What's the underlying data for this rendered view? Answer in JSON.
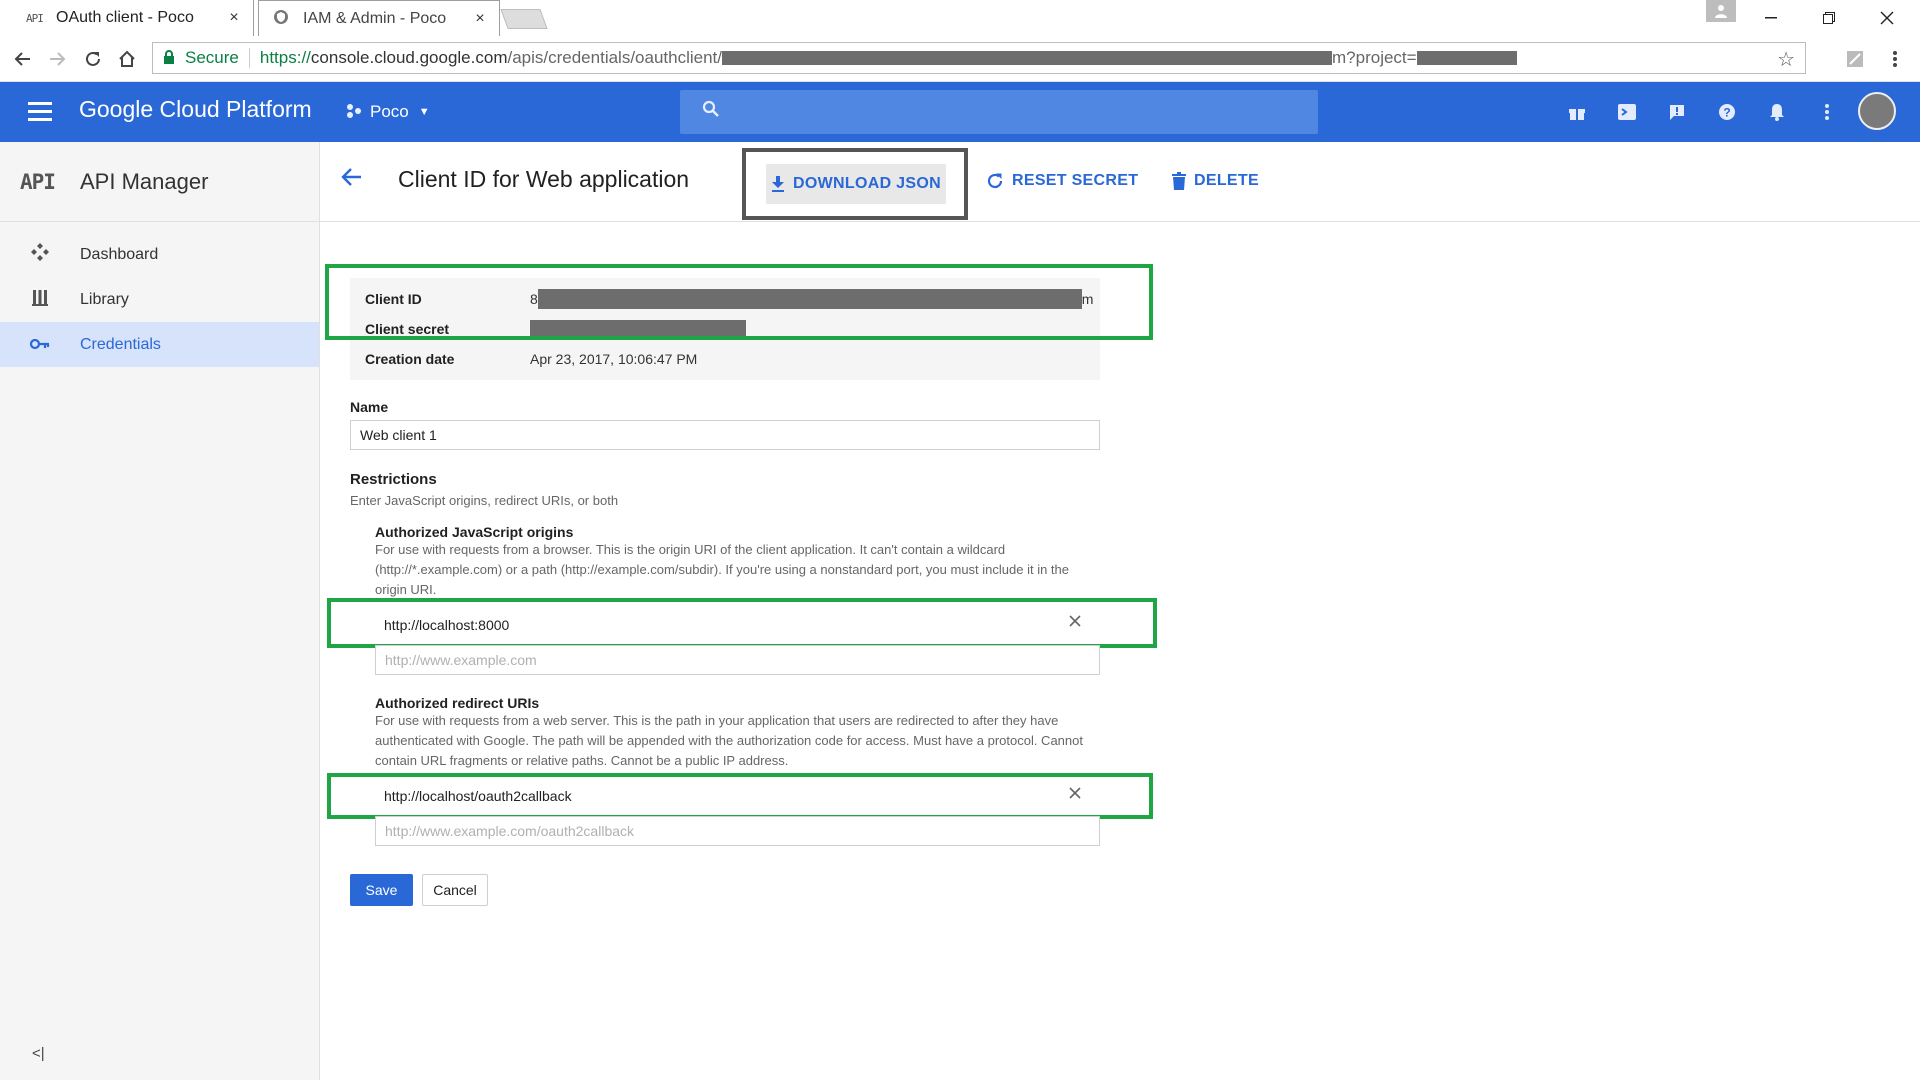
{
  "browser": {
    "tabs": [
      {
        "favicon": "API",
        "label": "OAuth client - Poco",
        "close": "×"
      },
      {
        "favicon": "shield",
        "label": "IAM & Admin - Poco",
        "close": "×"
      }
    ],
    "secure_label": "Secure",
    "url_prefix": "https://",
    "url_host": "console.cloud.google.com",
    "url_path": "/apis/credentials/oauthclient/",
    "url_suffix_tail": "m?project="
  },
  "header": {
    "brand": "Google Cloud Platform",
    "project": "Poco"
  },
  "sidebar": {
    "logo": "API",
    "title": "API Manager",
    "items": [
      {
        "label": "Dashboard",
        "icon": "dashboard-icon"
      },
      {
        "label": "Library",
        "icon": "library-icon"
      },
      {
        "label": "Credentials",
        "icon": "key-icon",
        "active": true
      }
    ],
    "collapse_label": "<|"
  },
  "page": {
    "title": "Client ID for Web application",
    "download_label": "DOWNLOAD JSON",
    "reset_label": "RESET SECRET",
    "delete_label": "DELETE"
  },
  "details": {
    "client_id_label": "Client ID",
    "client_id_prefix": "8",
    "client_id_suffix": "m",
    "client_secret_label": "Client secret",
    "creation_label": "Creation date",
    "creation_value": "Apr 23, 2017, 10:06:47 PM"
  },
  "form": {
    "name_label": "Name",
    "name_value": "Web client 1",
    "restrictions_label": "Restrictions",
    "restrictions_help": "Enter JavaScript origins, redirect URIs, or both",
    "js_origins_label": "Authorized JavaScript origins",
    "js_origins_help": "For use with requests from a browser. This is the origin URI of the client application. It can't contain a wildcard (http://*.example.com) or a path (http://example.com/subdir). If you're using a nonstandard port, you must include it in the origin URI.",
    "js_origin_value": "http://localhost:8000",
    "js_origin_placeholder": "http://www.example.com",
    "redirect_label": "Authorized redirect URIs",
    "redirect_help": "For use with requests from a web server. This is the path in your application that users are redirected to after they have authenticated with Google. The path will be appended with the authorization code for access. Must have a protocol. Cannot contain URL fragments or relative paths. Cannot be a public IP address.",
    "redirect_value": "http://localhost/oauth2callback",
    "redirect_placeholder": "http://www.example.com/oauth2callback",
    "save_label": "Save",
    "cancel_label": "Cancel"
  },
  "colors": {
    "brand_blue": "#2a68d8",
    "highlight_green": "#1fa544",
    "download_border": "#555555"
  }
}
